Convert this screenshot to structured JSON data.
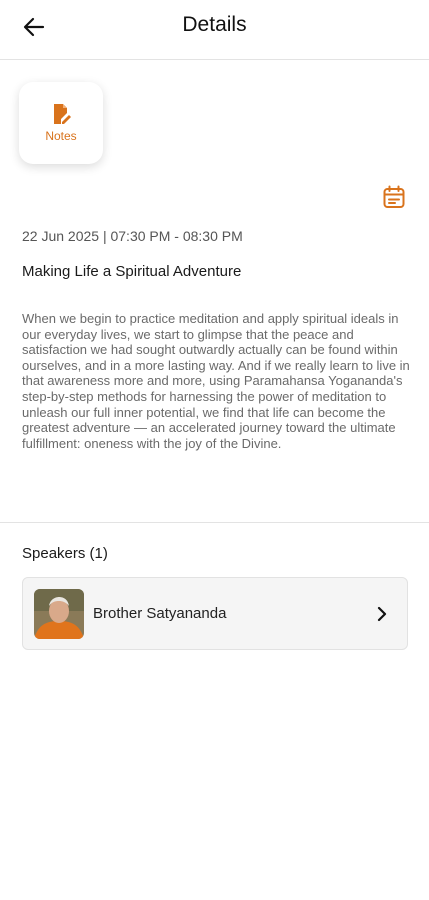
{
  "header": {
    "title": "Details",
    "back_icon": "arrow-left-icon"
  },
  "notes": {
    "label": "Notes",
    "icon": "note-edit-icon"
  },
  "calendar": {
    "icon": "calendar-icon"
  },
  "event": {
    "datetime": "22 Jun 2025 | 07:30 PM - 08:30 PM",
    "title": "Making Life a Spiritual Adventure",
    "description": "When we begin to practice meditation and apply spiritual ideals in our everyday lives, we start to glimpse that the peace and satisfaction we had sought outwardly actually can be found within ourselves, and in a more lasting way. And if we really learn to live in that awareness more and more, using Paramahansa Yogananda's step-by-step methods for harnessing the power of meditation to unleash our full inner potential, we find that life can become the greatest adventure — an accelerated journey toward the ultimate fulfillment: oneness with the joy of the Divine."
  },
  "speakers": {
    "heading": "Speakers (1)",
    "items": [
      {
        "name": "Brother Satyananda",
        "chevron_icon": "chevron-right-icon"
      }
    ]
  },
  "colors": {
    "accent": "#d9731c",
    "divider": "#e3e3e3",
    "card_bg": "#f5f5f5"
  }
}
